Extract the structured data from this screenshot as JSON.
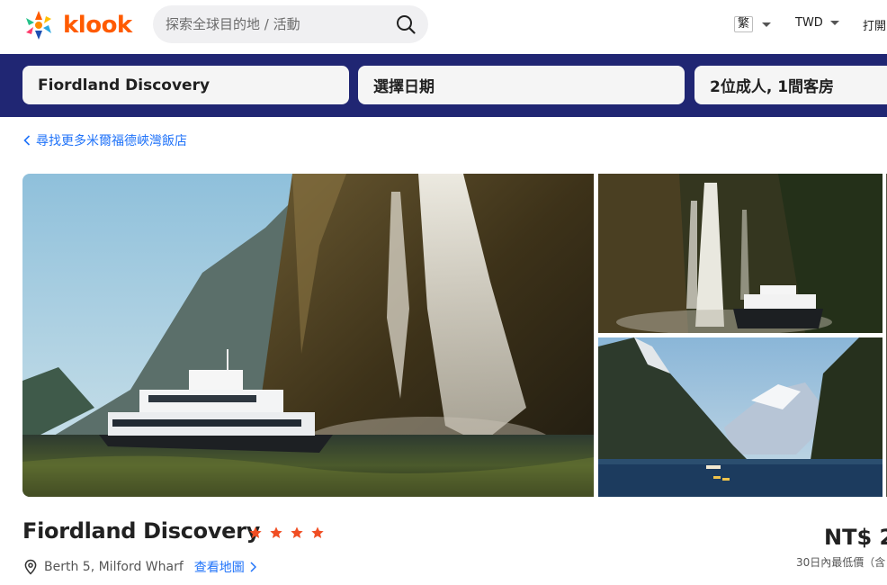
{
  "header": {
    "logo_text": "klook",
    "search_placeholder": "探索全球目的地 / 活動",
    "language": "繁",
    "currency": "TWD",
    "open_app": "打開",
    "brand_color": "#ff5b00"
  },
  "booking_bar": {
    "hotel": "Fiordland Discovery",
    "date": "選擇日期",
    "guests": "2位成人, 1間客房",
    "background": "#202673"
  },
  "back_link": "尋找更多米爾福德峽灣飯店",
  "gallery": {
    "photos": [
      {
        "name": "main-photo",
        "subject": "boat-beside-waterfall"
      },
      {
        "name": "top-right-photo",
        "subject": "waterfall-and-boat"
      },
      {
        "name": "bottom-right-photo",
        "subject": "fiord-mountains-kayaks"
      }
    ]
  },
  "hotel": {
    "name": "Fiordland Discovery",
    "stars": 4,
    "address": "Berth 5, Milford Wharf",
    "map_link": "查看地圖",
    "price": "NT$ 2",
    "price_note": "30日內最低價（含"
  },
  "colors": {
    "link": "#2073f9",
    "star": "#f04e23"
  }
}
